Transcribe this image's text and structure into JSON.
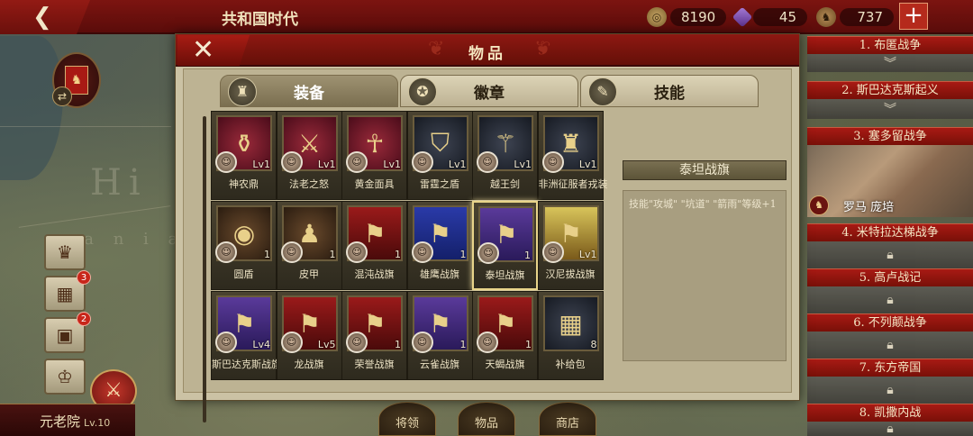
{
  "header": {
    "era_title": "共和国时代",
    "back_icon": "arrow-left",
    "resources": [
      {
        "name": "coins",
        "icon": "coin-icon",
        "value": "8190"
      },
      {
        "name": "gems",
        "icon": "gem-icon",
        "value": "45"
      },
      {
        "name": "soldiers",
        "icon": "helmet-icon",
        "value": "737"
      }
    ],
    "plus_label": "+"
  },
  "panel": {
    "title": "物品",
    "close_label": "✕",
    "tabs": [
      {
        "label": "装备",
        "active": true
      },
      {
        "label": "徽章",
        "active": false
      },
      {
        "label": "技能",
        "active": false
      }
    ]
  },
  "items": [
    {
      "name": "神农鼎",
      "level": "Lv1",
      "style": "red",
      "glyph": "⚱"
    },
    {
      "name": "法老之怒",
      "level": "Lv1",
      "style": "red",
      "glyph": "⚔"
    },
    {
      "name": "黄金面具",
      "level": "Lv1",
      "style": "red",
      "glyph": "☥"
    },
    {
      "name": "雷霆之盾",
      "level": "Lv1",
      "style": "dark",
      "glyph": "⛉"
    },
    {
      "name": "越王剑",
      "level": "Lv1",
      "style": "dark",
      "glyph": "⚚"
    },
    {
      "name": "非洲征服者戎装",
      "level": "Lv1",
      "style": "dark",
      "glyph": "♜"
    },
    {
      "name": "圆盾",
      "level": "1",
      "style": "brown",
      "glyph": "◉"
    },
    {
      "name": "皮甲",
      "level": "1",
      "style": "brown",
      "glyph": "♟"
    },
    {
      "name": "混沌战旗",
      "level": "1",
      "style": "crim",
      "glyph": "⚑"
    },
    {
      "name": "雄鹰战旗",
      "level": "1",
      "style": "blue",
      "glyph": "⚑"
    },
    {
      "name": "泰坦战旗",
      "level": "1",
      "style": "purple",
      "glyph": "⚑",
      "selected": true
    },
    {
      "name": "汉尼拔战旗",
      "level": "Lv1",
      "style": "gold",
      "glyph": "⚑"
    },
    {
      "name": "斯巴达克斯战旗",
      "level": "Lv4",
      "style": "purple",
      "glyph": "⚑"
    },
    {
      "name": "龙战旗",
      "level": "Lv5",
      "style": "crim",
      "glyph": "⚑"
    },
    {
      "name": "荣誉战旗",
      "level": "1",
      "style": "crim",
      "glyph": "⚑"
    },
    {
      "name": "云雀战旗",
      "level": "1",
      "style": "purple",
      "glyph": "⚑"
    },
    {
      "name": "天蝎战旗",
      "level": "1",
      "style": "crim",
      "glyph": "⚑"
    },
    {
      "name": "补给包",
      "level": "8",
      "style": "dark",
      "glyph": "▦"
    }
  ],
  "detail": {
    "title": "泰坦战旗",
    "text": "技能\"攻城\" \"坑道\" \"箭雨\"等级+1"
  },
  "campaigns": [
    {
      "label": "1. 布匿战争",
      "sub": "chevron-down"
    },
    {
      "label": "2. 斯巴达克斯起义",
      "sub": "chevron-down"
    },
    {
      "label": "3. 塞多留战争",
      "sub": "scene",
      "factions": "罗马 庞培"
    },
    {
      "label": "4. 米特拉达梯战争",
      "sub": "lock"
    },
    {
      "label": "5. 高卢战记",
      "sub": "lock"
    },
    {
      "label": "6. 不列颠战争",
      "sub": "lock"
    },
    {
      "label": "7. 东方帝国",
      "sub": "lock"
    },
    {
      "label": "8. 凯撒内战",
      "sub": "lock"
    }
  ],
  "side": {
    "badges": [
      "3",
      "2"
    ],
    "senate_label": "元老院",
    "senate_level": "Lv.10"
  },
  "bottom_nav": [
    "将领",
    "物品",
    "商店"
  ]
}
